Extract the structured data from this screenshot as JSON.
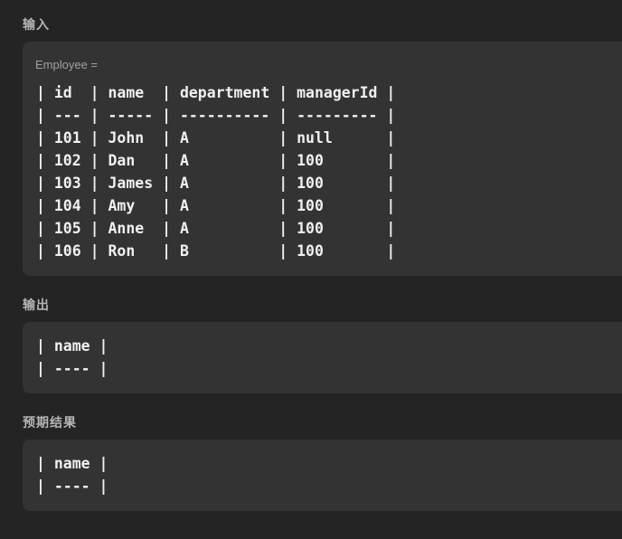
{
  "input": {
    "heading": "输入",
    "variable_label": "Employee =",
    "table_lines": [
      "| id  | name  | department | managerId |",
      "| --- | ----- | ---------- | --------- |",
      "| 101 | John  | A          | null      |",
      "| 102 | Dan   | A          | 100       |",
      "| 103 | James | A          | 100       |",
      "| 104 | Amy   | A          | 100       |",
      "| 105 | Anne  | A          | 100       |",
      "| 106 | Ron   | B          | 100       |"
    ]
  },
  "output": {
    "heading": "输出",
    "table_lines": [
      "| name |",
      "| ---- |"
    ]
  },
  "expected": {
    "heading": "预期结果",
    "table_lines": [
      "| name |",
      "| ---- |"
    ]
  }
}
